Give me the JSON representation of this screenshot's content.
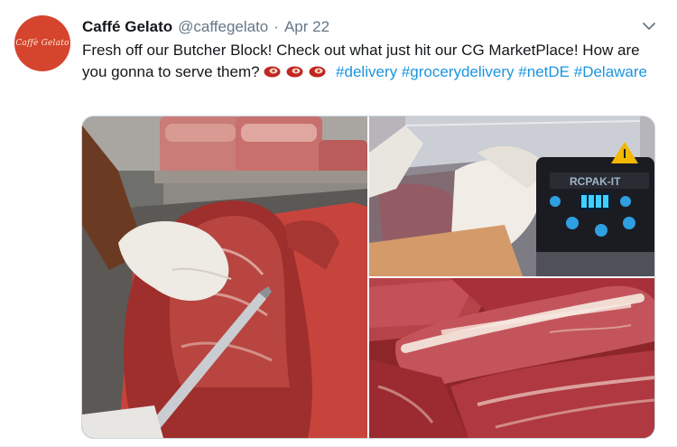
{
  "tweet": {
    "avatar_icon": "caffe-gelato-logo",
    "avatar_logo_text": "Caffè Gelato",
    "display_name": "Caffé Gelato",
    "handle": "@caffegelato",
    "separator": "·",
    "date": "Apr 22",
    "text_part1": "Fresh off our Butcher Block! Check out what just hit our CG MarketPlace! How are you gonna to serve them?",
    "hashtags": [
      "#delivery",
      "#grocerydelivery",
      "#netDE",
      "#Delaware"
    ],
    "emoji_icons": [
      "cut-of-meat-icon",
      "cut-of-meat-icon",
      "cut-of-meat-icon"
    ],
    "menu_icon": "chevron-down-icon",
    "colors": {
      "name": "#14171a",
      "secondary": "#657786",
      "link": "#1b95e0",
      "avatar_bg": "#d5452e"
    },
    "media": [
      {
        "icon": "photo-butcher-trimming-meat"
      },
      {
        "icon": "photo-vacuum-sealer-machine"
      },
      {
        "icon": "photo-raw-steaks"
      }
    ]
  }
}
